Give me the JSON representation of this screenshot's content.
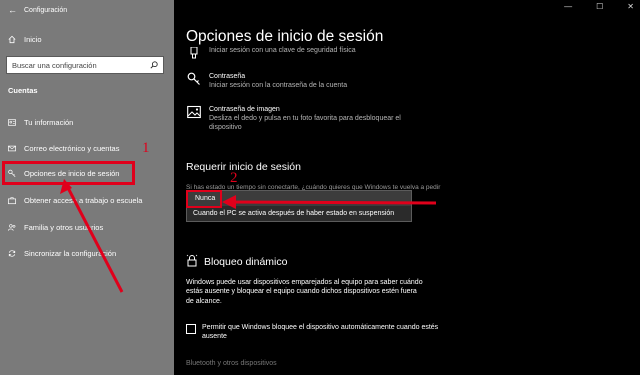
{
  "window": {
    "app_title": "Configuración",
    "controls": [
      "—",
      "☐",
      "✕"
    ]
  },
  "sidebar": {
    "home_label": "Inicio",
    "search_placeholder": "Buscar una configuración",
    "section_title": "Cuentas",
    "items": [
      {
        "label": "Tu información",
        "icon": "person-card-icon"
      },
      {
        "label": "Correo electrónico y cuentas",
        "icon": "mail-icon"
      },
      {
        "label": "Opciones de inicio de sesión",
        "icon": "key-icon"
      },
      {
        "label": "Obtener acceso a trabajo o escuela",
        "icon": "briefcase-icon"
      },
      {
        "label": "Familia y otros usuarios",
        "icon": "people-icon"
      },
      {
        "label": "Sincronizar la configuración",
        "icon": "sync-icon"
      }
    ]
  },
  "annotations": {
    "marker_1": "1",
    "marker_2": "2",
    "color": "#e0001b"
  },
  "main": {
    "page_title": "Opciones de inicio de sesión",
    "options": [
      {
        "title": "",
        "desc": "Iniciar sesión con una clave de seguridad física",
        "icon": "usb-key-icon"
      },
      {
        "title": "Contraseña",
        "desc": "Iniciar sesión con la contraseña de la cuenta",
        "icon": "key-icon"
      },
      {
        "title": "Contraseña de imagen",
        "desc": "Desliza el dedo y pulsa en tu foto favorita para desbloquear el dispositivo",
        "icon": "picture-icon"
      }
    ],
    "require_title": "Requerir inicio de sesión",
    "require_desc": "Si has estado un tiempo sin conectarte, ¿cuándo quieres que Windows te vuelva a pedir",
    "dropdown_options": [
      "Nunca",
      "Cuando el PC se activa después de haber estado en suspensión"
    ],
    "dynamic_lock_title": "Bloqueo dinámico",
    "dynamic_lock_desc": "Windows puede usar dispositivos emparejados al equipo para saber cuándo estás ausente y bloquear el equipo cuando dichos dispositivos estén fuera de alcance.",
    "checkbox_label": "Permitir que Windows bloquee el dispositivo automáticamente cuando estés ausente",
    "footer_text": "Bluetooth y otros dispositivos"
  }
}
